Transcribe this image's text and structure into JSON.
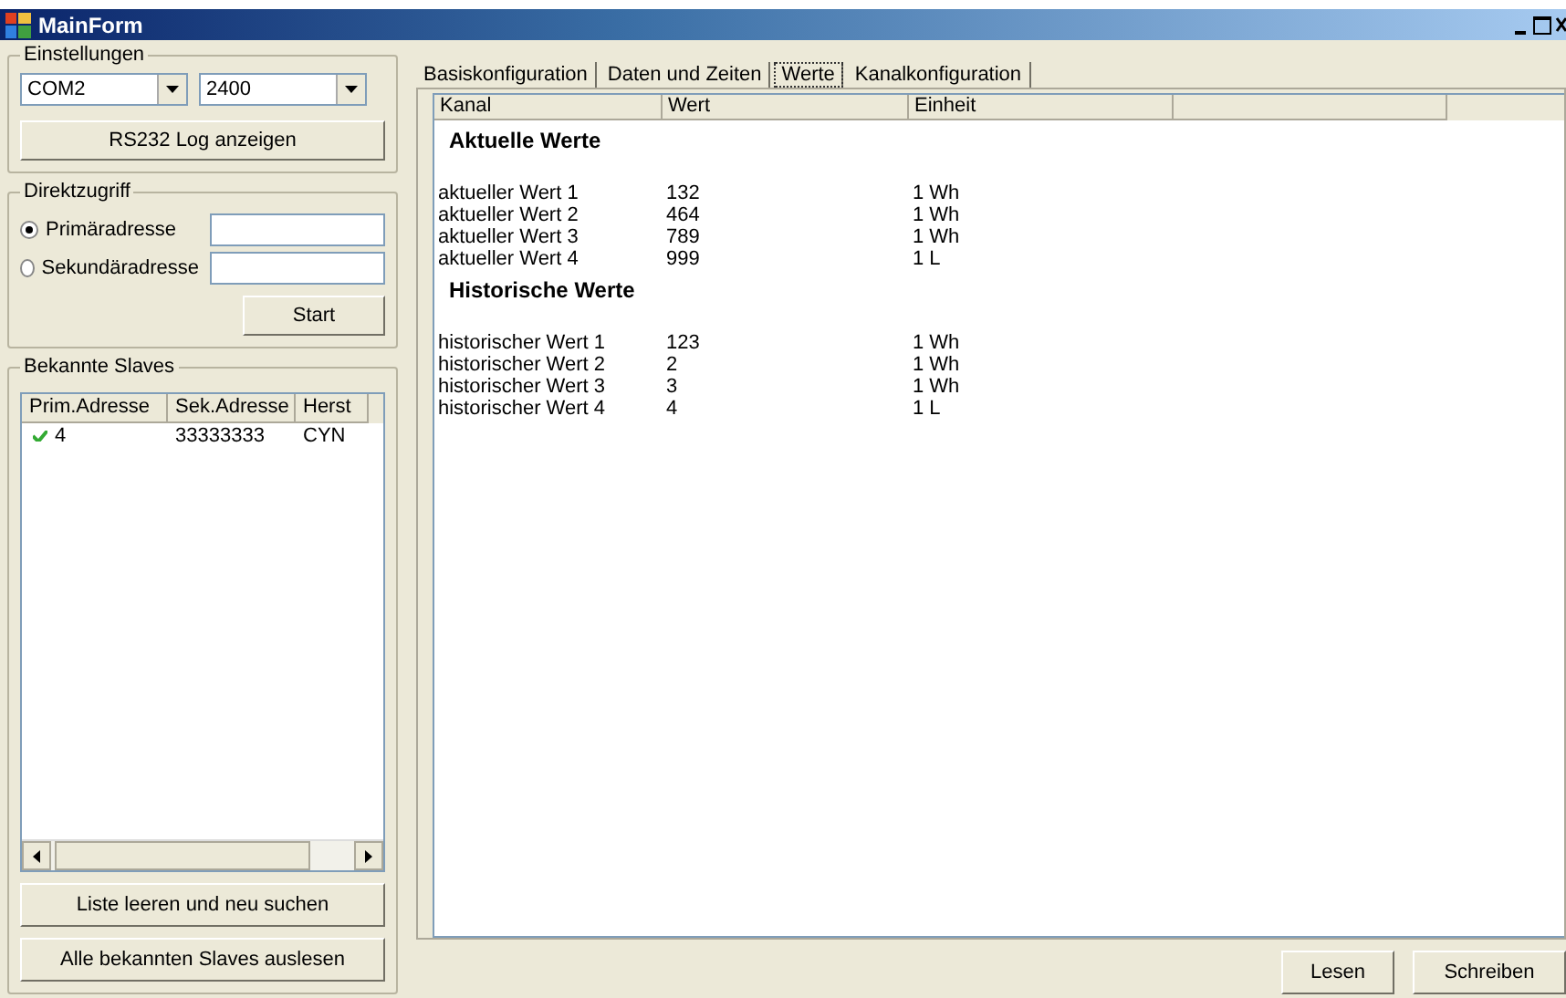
{
  "window": {
    "title": "MainForm"
  },
  "settings": {
    "title": "Einstellungen",
    "port": "COM2",
    "baud": "2400",
    "log_button": "RS232 Log anzeigen"
  },
  "direct_access": {
    "title": "Direktzugriff",
    "options": [
      {
        "label": "Primäradresse",
        "selected": true
      },
      {
        "label": "Sekundäradresse",
        "selected": false
      }
    ],
    "start_button": "Start"
  },
  "slaves": {
    "title": "Bekannte Slaves",
    "columns": [
      "Prim.Adresse",
      "Sek.Adresse",
      "Herst"
    ],
    "rows": [
      {
        "prim": "4",
        "sek": "33333333",
        "manufacturer": "CYN"
      }
    ],
    "buttons": [
      "Liste leeren und neu suchen",
      "Alle bekannten Slaves auslesen"
    ]
  },
  "tabs": [
    {
      "label": "Basiskonfiguration",
      "selected": false
    },
    {
      "label": "Daten und Zeiten",
      "selected": false
    },
    {
      "label": "Werte",
      "selected": true
    },
    {
      "label": "Kanalkonfiguration",
      "selected": false
    }
  ],
  "table": {
    "columns": [
      "Kanal",
      "Wert",
      "Einheit"
    ],
    "groups": [
      {
        "title": "Aktuelle Werte",
        "rows": [
          {
            "channel": "aktueller Wert 1",
            "value": "132",
            "unit": "1 Wh"
          },
          {
            "channel": "aktueller Wert 2",
            "value": "464",
            "unit": "1 Wh"
          },
          {
            "channel": "aktueller Wert 3",
            "value": "789",
            "unit": "1 Wh"
          },
          {
            "channel": "aktueller Wert 4",
            "value": "999",
            "unit": "1 L"
          }
        ]
      },
      {
        "title": "Historische Werte",
        "rows": [
          {
            "channel": "historischer Wert 1",
            "value": "123",
            "unit": "1 Wh"
          },
          {
            "channel": "historischer Wert 2",
            "value": "2",
            "unit": "1 Wh"
          },
          {
            "channel": "historischer Wert 3",
            "value": "3",
            "unit": "1 Wh"
          },
          {
            "channel": "historischer Wert 4",
            "value": "4",
            "unit": "1 L"
          }
        ]
      }
    ]
  },
  "buttons": [
    "Lesen",
    "Schreiben"
  ]
}
